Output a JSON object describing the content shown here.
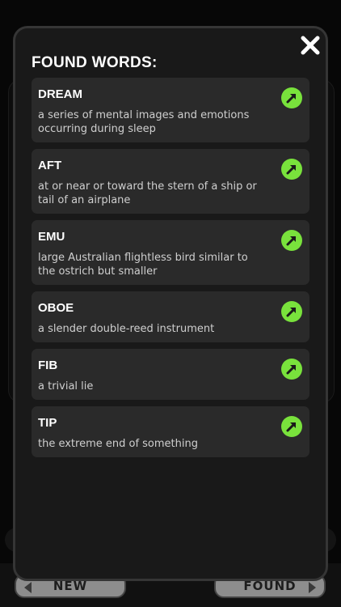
{
  "background": {
    "new_button_label": "NEW",
    "found_button_label": "FOUND"
  },
  "modal": {
    "title": "FOUND WORDS:",
    "close_icon": "close-icon",
    "accent_color": "#79e23c",
    "words": [
      {
        "word": "DREAM",
        "definition": "a series of mental images and emotions occurring during sleep"
      },
      {
        "word": "AFT",
        "definition": "at or near or toward the stern of a ship or tail of an airplane"
      },
      {
        "word": "EMU",
        "definition": "large Australian flightless bird similar to the ostrich but smaller"
      },
      {
        "word": "OBOE",
        "definition": "a slender double-reed instrument"
      },
      {
        "word": "FIB",
        "definition": "a trivial lie"
      },
      {
        "word": "TIP",
        "definition": "the extreme end of something"
      }
    ]
  }
}
